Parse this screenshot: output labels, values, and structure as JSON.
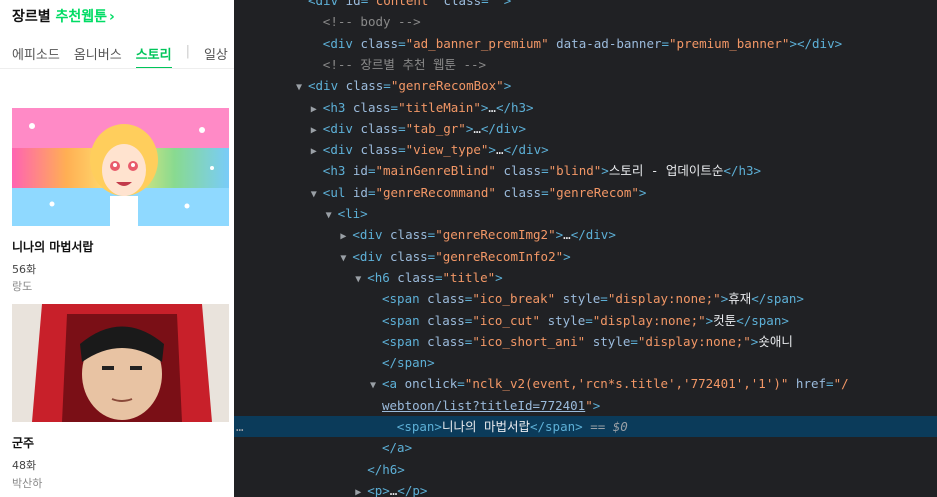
{
  "page": {
    "section_title_prefix": "장르별 ",
    "section_title_accent": "추천웹툰",
    "section_title_chevron": "›",
    "tabs": [
      {
        "label": "에피소드",
        "active": false
      },
      {
        "label": "옴니버스",
        "active": false
      },
      {
        "label": "스토리",
        "active": true
      },
      {
        "label": "일상",
        "active": false
      }
    ],
    "cards": [
      {
        "name": "니나의 마법서랍",
        "count": "56화",
        "author": "랑도"
      },
      {
        "name": "군주",
        "count": "48화",
        "author": "박산하"
      }
    ]
  },
  "devtools": {
    "selected_marker": "…",
    "lines": [
      {
        "indent": 5,
        "arrow": "",
        "parts": [
          [
            "tag",
            "<div "
          ],
          [
            "attr",
            "id"
          ],
          [
            "tag",
            "="
          ],
          [
            "val",
            "\"content\""
          ],
          [
            "attr",
            " class"
          ],
          [
            "tag",
            "="
          ],
          [
            "val",
            "\"\""
          ],
          [
            "tag",
            ">"
          ]
        ]
      },
      {
        "indent": 6,
        "arrow": "",
        "parts": [
          [
            "cmt",
            "<!-- body -->"
          ]
        ]
      },
      {
        "indent": 6,
        "arrow": "",
        "parts": [
          [
            "tag",
            "<div "
          ],
          [
            "attr",
            "class"
          ],
          [
            "tag",
            "="
          ],
          [
            "val",
            "\"ad_banner_premium\""
          ],
          [
            "attr",
            " data-ad-banner"
          ],
          [
            "tag",
            "="
          ],
          [
            "val",
            "\"premium_banner\""
          ],
          [
            "tag",
            "></div>"
          ]
        ]
      },
      {
        "indent": 6,
        "arrow": "",
        "parts": [
          [
            "cmt",
            "<!-- 장르별 추천 웹툰 -->"
          ]
        ]
      },
      {
        "indent": 5,
        "arrow": "▼",
        "parts": [
          [
            "tag",
            "<div "
          ],
          [
            "attr",
            "class"
          ],
          [
            "tag",
            "="
          ],
          [
            "val",
            "\"genreRecomBox\""
          ],
          [
            "tag",
            ">"
          ]
        ]
      },
      {
        "indent": 6,
        "arrow": "▶",
        "parts": [
          [
            "tag",
            "<h3 "
          ],
          [
            "attr",
            "class"
          ],
          [
            "tag",
            "="
          ],
          [
            "val",
            "\"titleMain\""
          ],
          [
            "tag",
            ">"
          ],
          [
            "txt",
            "…"
          ],
          [
            "tag",
            "</h3>"
          ]
        ]
      },
      {
        "indent": 6,
        "arrow": "▶",
        "parts": [
          [
            "tag",
            "<div "
          ],
          [
            "attr",
            "class"
          ],
          [
            "tag",
            "="
          ],
          [
            "val",
            "\"tab_gr\""
          ],
          [
            "tag",
            ">"
          ],
          [
            "txt",
            "…"
          ],
          [
            "tag",
            "</div>"
          ]
        ]
      },
      {
        "indent": 6,
        "arrow": "▶",
        "parts": [
          [
            "tag",
            "<div "
          ],
          [
            "attr",
            "class"
          ],
          [
            "tag",
            "="
          ],
          [
            "val",
            "\"view_type\""
          ],
          [
            "tag",
            ">"
          ],
          [
            "txt",
            "…"
          ],
          [
            "tag",
            "</div>"
          ]
        ]
      },
      {
        "indent": 6,
        "arrow": "",
        "parts": [
          [
            "tag",
            "<h3 "
          ],
          [
            "attr",
            "id"
          ],
          [
            "tag",
            "="
          ],
          [
            "val",
            "\"mainGenreBlind\""
          ],
          [
            "attr",
            " class"
          ],
          [
            "tag",
            "="
          ],
          [
            "val",
            "\"blind\""
          ],
          [
            "tag",
            ">"
          ],
          [
            "txt",
            "스토리 - 업데이트순"
          ],
          [
            "tag",
            "</h3>"
          ]
        ]
      },
      {
        "indent": 6,
        "arrow": "▼",
        "parts": [
          [
            "tag",
            "<ul "
          ],
          [
            "attr",
            "id"
          ],
          [
            "tag",
            "="
          ],
          [
            "val",
            "\"genreRecommand\""
          ],
          [
            "attr",
            " class"
          ],
          [
            "tag",
            "="
          ],
          [
            "val",
            "\"genreRecom\""
          ],
          [
            "tag",
            ">"
          ]
        ]
      },
      {
        "indent": 7,
        "arrow": "▼",
        "parts": [
          [
            "tag",
            "<li>"
          ]
        ]
      },
      {
        "indent": 8,
        "arrow": "▶",
        "parts": [
          [
            "tag",
            "<div "
          ],
          [
            "attr",
            "class"
          ],
          [
            "tag",
            "="
          ],
          [
            "val",
            "\"genreRecomImg2\""
          ],
          [
            "tag",
            ">"
          ],
          [
            "txt",
            "…"
          ],
          [
            "tag",
            "</div>"
          ]
        ]
      },
      {
        "indent": 8,
        "arrow": "▼",
        "parts": [
          [
            "tag",
            "<div "
          ],
          [
            "attr",
            "class"
          ],
          [
            "tag",
            "="
          ],
          [
            "val",
            "\"genreRecomInfo2\""
          ],
          [
            "tag",
            ">"
          ]
        ]
      },
      {
        "indent": 9,
        "arrow": "▼",
        "parts": [
          [
            "tag",
            "<h6 "
          ],
          [
            "attr",
            "class"
          ],
          [
            "tag",
            "="
          ],
          [
            "val",
            "\"title\""
          ],
          [
            "tag",
            ">"
          ]
        ]
      },
      {
        "indent": 10,
        "arrow": "",
        "parts": [
          [
            "tag",
            "<span "
          ],
          [
            "attr",
            "class"
          ],
          [
            "tag",
            "="
          ],
          [
            "val",
            "\"ico_break\""
          ],
          [
            "attr",
            " style"
          ],
          [
            "tag",
            "="
          ],
          [
            "val",
            "\"display:none;\""
          ],
          [
            "tag",
            ">"
          ],
          [
            "txt",
            "휴재"
          ],
          [
            "tag",
            "</span>"
          ]
        ]
      },
      {
        "indent": 10,
        "arrow": "",
        "parts": [
          [
            "tag",
            "<span "
          ],
          [
            "attr",
            "class"
          ],
          [
            "tag",
            "="
          ],
          [
            "val",
            "\"ico_cut\""
          ],
          [
            "attr",
            " style"
          ],
          [
            "tag",
            "="
          ],
          [
            "val",
            "\"display:none;\""
          ],
          [
            "tag",
            ">"
          ],
          [
            "txt",
            "컷툰"
          ],
          [
            "tag",
            "</span>"
          ]
        ]
      },
      {
        "indent": 10,
        "arrow": "",
        "parts": [
          [
            "tag",
            "<span "
          ],
          [
            "attr",
            "class"
          ],
          [
            "tag",
            "="
          ],
          [
            "val",
            "\"ico_short_ani\""
          ],
          [
            "attr",
            " style"
          ],
          [
            "tag",
            "="
          ],
          [
            "val",
            "\"display:none;\""
          ],
          [
            "tag",
            ">"
          ],
          [
            "txt",
            "숏애니"
          ]
        ]
      },
      {
        "indent": 10,
        "arrow": "",
        "parts": [
          [
            "tag",
            "</span>"
          ]
        ]
      },
      {
        "indent": 10,
        "arrow": "▼",
        "parts": [
          [
            "tag",
            "<a "
          ],
          [
            "attr",
            "onclick"
          ],
          [
            "tag",
            "="
          ],
          [
            "val",
            "\"nclk_v2(event,'rcn*s.title','772401','1')\""
          ],
          [
            "attr",
            " href"
          ],
          [
            "tag",
            "="
          ],
          [
            "val",
            "\"/"
          ]
        ]
      },
      {
        "indent": 10,
        "arrow": "",
        "parts": [
          [
            "link",
            "webtoon/list?titleId=772401"
          ],
          [
            "val",
            "\""
          ],
          [
            "tag",
            ">"
          ]
        ]
      },
      {
        "indent": 11,
        "arrow": "",
        "selected": true,
        "parts": [
          [
            "tag",
            "<span>"
          ],
          [
            "txt",
            "니나의 마법서랍"
          ],
          [
            "tag",
            "</span>"
          ],
          [
            "eq",
            " == "
          ],
          [
            "dollar",
            "$0"
          ]
        ]
      },
      {
        "indent": 10,
        "arrow": "",
        "parts": [
          [
            "tag",
            "</a>"
          ]
        ]
      },
      {
        "indent": 9,
        "arrow": "",
        "parts": [
          [
            "tag",
            "</h6>"
          ]
        ]
      },
      {
        "indent": 9,
        "arrow": "▶",
        "parts": [
          [
            "tag",
            "<p>"
          ],
          [
            "txt",
            "…"
          ],
          [
            "tag",
            "</p>"
          ]
        ]
      }
    ]
  }
}
